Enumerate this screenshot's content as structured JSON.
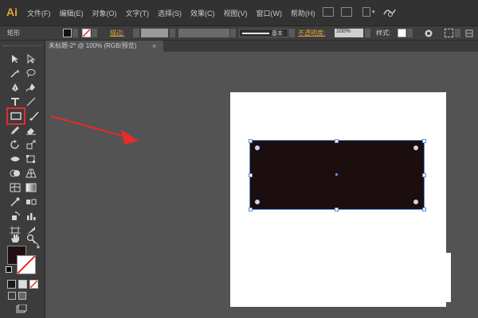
{
  "app": {
    "logo": "Ai",
    "menus": [
      "文件(F)",
      "编辑(E)",
      "对象(O)",
      "文字(T)",
      "选择(S)",
      "效果(C)",
      "视图(V)",
      "窗口(W)",
      "帮助(H)"
    ]
  },
  "control_bar": {
    "object_label": "矩形",
    "stroke_label": "描边:",
    "stroke_style": "基本",
    "opacity_label": "不透明度:",
    "opacity_value": "100%",
    "style_label": "样式:"
  },
  "document": {
    "tab_title": "未标题-2* @ 100% (RGB/预览)",
    "tab_close": "×"
  },
  "colors": {
    "fill": "#221011",
    "stroke": "#ffffff",
    "shape": "#1c0d0e",
    "selection": "#5b8bd9",
    "annotation_arrow": "#e52b2b",
    "logo": "#e2a33a"
  },
  "icons": [
    "selection-tool-icon",
    "direct-selection-tool-icon",
    "magic-wand-icon",
    "lasso-icon",
    "pen-tool-icon",
    "curvature-tool-icon",
    "type-tool-icon",
    "line-tool-icon",
    "rectangle-tool-icon",
    "paintbrush-icon",
    "pencil-icon",
    "eraser-icon",
    "rotate-icon",
    "scale-icon",
    "width-tool-icon",
    "free-transform-icon",
    "shape-builder-icon",
    "perspective-grid-icon",
    "mesh-icon",
    "gradient-icon",
    "eyedropper-icon",
    "blend-icon",
    "symbol-sprayer-icon",
    "column-graph-icon",
    "artboard-tool-icon",
    "slice-icon",
    "hand-icon",
    "zoom-icon",
    "swap-icon",
    "screen-mode-icon"
  ]
}
